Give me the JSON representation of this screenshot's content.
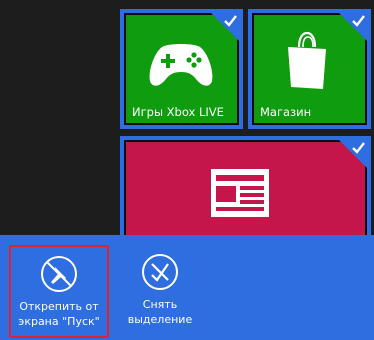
{
  "tiles": [
    {
      "label": "Игры Xbox LIVE",
      "icon": "xbox-controller-icon",
      "selected": true,
      "color": "#0f9d0f"
    },
    {
      "label": "Магазин",
      "icon": "store-bag-icon",
      "selected": true,
      "color": "#0f9d0f"
    },
    {
      "label": "",
      "icon": "news-icon",
      "selected": true,
      "color": "#c5164b"
    }
  ],
  "appbar": {
    "unpin": {
      "line1": "Открепить от",
      "line2": "экрана \"Пуск\"",
      "icon": "unpin-icon"
    },
    "clear": {
      "line1": "Снять",
      "line2": "выделение",
      "icon": "clear-selection-icon"
    }
  },
  "colors": {
    "accent": "#2e6ee0",
    "tile_green": "#0f9d0f",
    "tile_red": "#c5164b",
    "highlight_border": "#e0242d",
    "background": "#1d1d1d"
  }
}
